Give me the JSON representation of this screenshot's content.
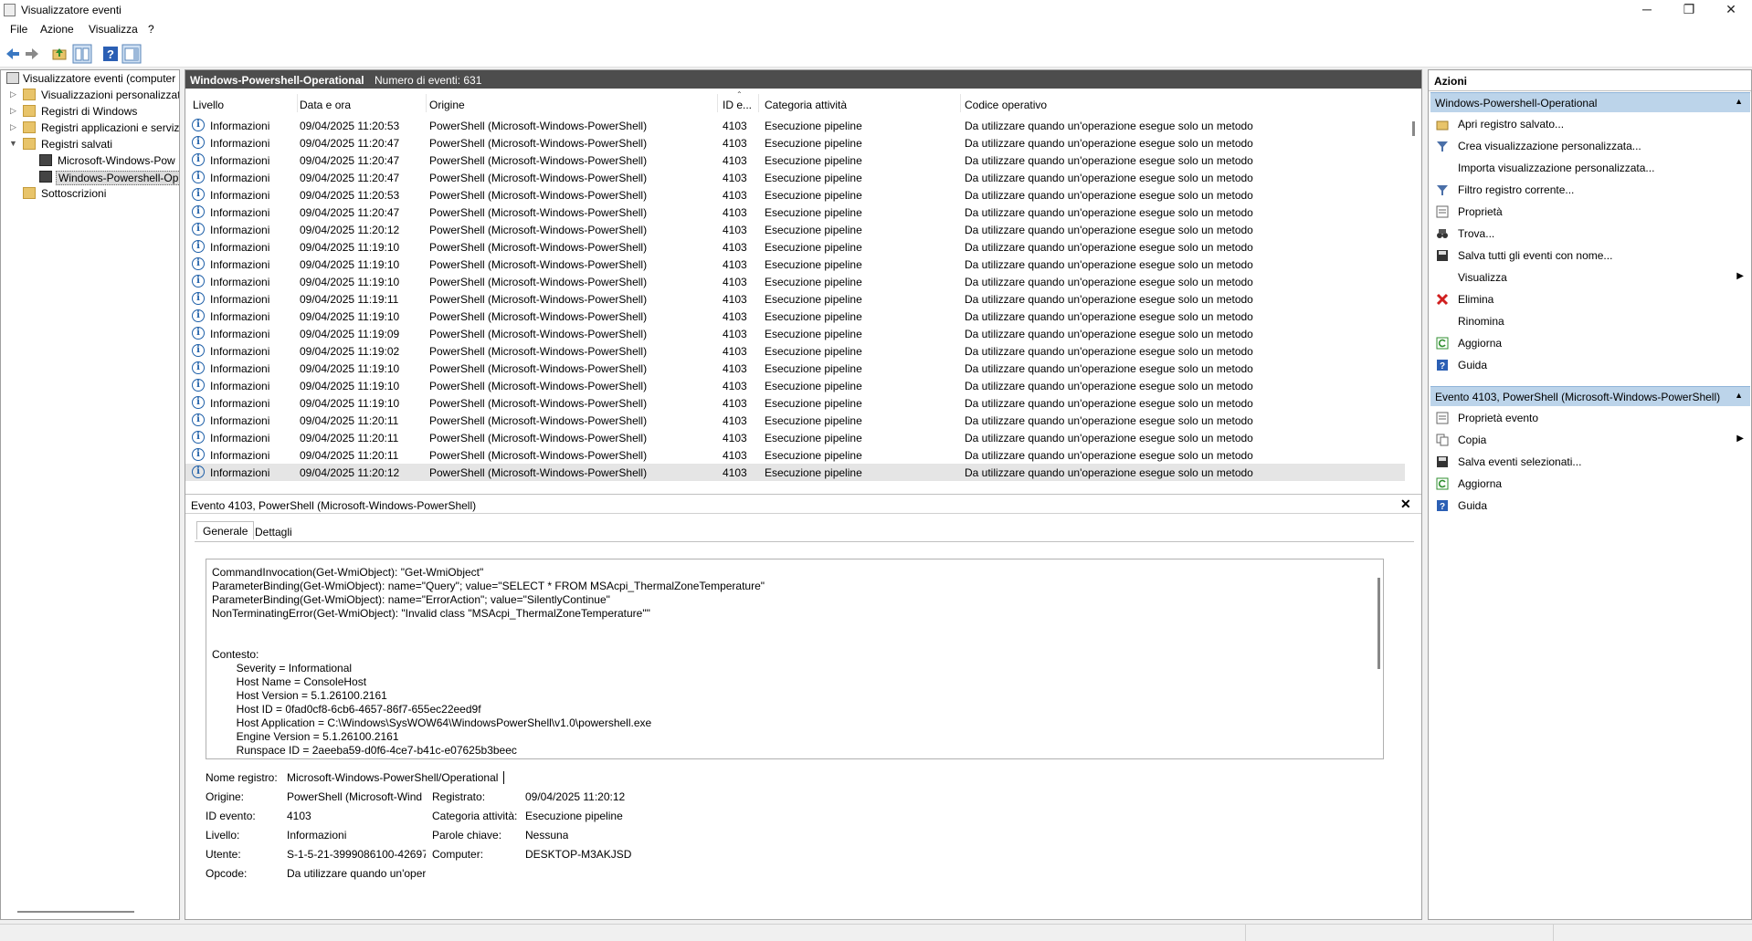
{
  "window": {
    "title": "Visualizzatore eventi",
    "minimize": "─",
    "maximize": "❐",
    "close": "✕"
  },
  "menu": [
    "File",
    "Azione",
    "Visualizza",
    "?"
  ],
  "tree": {
    "root": "Visualizzatore eventi (computer",
    "custom_views": "Visualizzazioni personalizzate",
    "windows_logs": "Registri di Windows",
    "app_logs": "Registri applicazioni e servizi",
    "saved_logs": "Registri salvati",
    "saved_1": "Microsoft-Windows-Pow",
    "saved_2": "Windows-Powershell-Op",
    "subscriptions": "Sottoscrizioni"
  },
  "list": {
    "title": "Windows-Powershell-Operational",
    "count": "Numero di eventi: 631",
    "columns": [
      "Livello",
      "Data e ora",
      "Origine",
      "ID e...",
      "Categoria attività",
      "Codice operativo"
    ],
    "rows": [
      {
        "level": "Informazioni",
        "date": "09/04/2025 11:20:53",
        "source": "PowerShell (Microsoft-Windows-PowerShell)",
        "id": "4103",
        "category": "Esecuzione pipeline",
        "opcode": "Da utilizzare quando un'operazione esegue solo un metodo"
      },
      {
        "level": "Informazioni",
        "date": "09/04/2025 11:20:47",
        "source": "PowerShell (Microsoft-Windows-PowerShell)",
        "id": "4103",
        "category": "Esecuzione pipeline",
        "opcode": "Da utilizzare quando un'operazione esegue solo un metodo"
      },
      {
        "level": "Informazioni",
        "date": "09/04/2025 11:20:47",
        "source": "PowerShell (Microsoft-Windows-PowerShell)",
        "id": "4103",
        "category": "Esecuzione pipeline",
        "opcode": "Da utilizzare quando un'operazione esegue solo un metodo"
      },
      {
        "level": "Informazioni",
        "date": "09/04/2025 11:20:47",
        "source": "PowerShell (Microsoft-Windows-PowerShell)",
        "id": "4103",
        "category": "Esecuzione pipeline",
        "opcode": "Da utilizzare quando un'operazione esegue solo un metodo"
      },
      {
        "level": "Informazioni",
        "date": "09/04/2025 11:20:53",
        "source": "PowerShell (Microsoft-Windows-PowerShell)",
        "id": "4103",
        "category": "Esecuzione pipeline",
        "opcode": "Da utilizzare quando un'operazione esegue solo un metodo"
      },
      {
        "level": "Informazioni",
        "date": "09/04/2025 11:20:47",
        "source": "PowerShell (Microsoft-Windows-PowerShell)",
        "id": "4103",
        "category": "Esecuzione pipeline",
        "opcode": "Da utilizzare quando un'operazione esegue solo un metodo"
      },
      {
        "level": "Informazioni",
        "date": "09/04/2025 11:20:12",
        "source": "PowerShell (Microsoft-Windows-PowerShell)",
        "id": "4103",
        "category": "Esecuzione pipeline",
        "opcode": "Da utilizzare quando un'operazione esegue solo un metodo"
      },
      {
        "level": "Informazioni",
        "date": "09/04/2025 11:19:10",
        "source": "PowerShell (Microsoft-Windows-PowerShell)",
        "id": "4103",
        "category": "Esecuzione pipeline",
        "opcode": "Da utilizzare quando un'operazione esegue solo un metodo"
      },
      {
        "level": "Informazioni",
        "date": "09/04/2025 11:19:10",
        "source": "PowerShell (Microsoft-Windows-PowerShell)",
        "id": "4103",
        "category": "Esecuzione pipeline",
        "opcode": "Da utilizzare quando un'operazione esegue solo un metodo"
      },
      {
        "level": "Informazioni",
        "date": "09/04/2025 11:19:10",
        "source": "PowerShell (Microsoft-Windows-PowerShell)",
        "id": "4103",
        "category": "Esecuzione pipeline",
        "opcode": "Da utilizzare quando un'operazione esegue solo un metodo"
      },
      {
        "level": "Informazioni",
        "date": "09/04/2025 11:19:11",
        "source": "PowerShell (Microsoft-Windows-PowerShell)",
        "id": "4103",
        "category": "Esecuzione pipeline",
        "opcode": "Da utilizzare quando un'operazione esegue solo un metodo"
      },
      {
        "level": "Informazioni",
        "date": "09/04/2025 11:19:10",
        "source": "PowerShell (Microsoft-Windows-PowerShell)",
        "id": "4103",
        "category": "Esecuzione pipeline",
        "opcode": "Da utilizzare quando un'operazione esegue solo un metodo"
      },
      {
        "level": "Informazioni",
        "date": "09/04/2025 11:19:09",
        "source": "PowerShell (Microsoft-Windows-PowerShell)",
        "id": "4103",
        "category": "Esecuzione pipeline",
        "opcode": "Da utilizzare quando un'operazione esegue solo un metodo"
      },
      {
        "level": "Informazioni",
        "date": "09/04/2025 11:19:02",
        "source": "PowerShell (Microsoft-Windows-PowerShell)",
        "id": "4103",
        "category": "Esecuzione pipeline",
        "opcode": "Da utilizzare quando un'operazione esegue solo un metodo"
      },
      {
        "level": "Informazioni",
        "date": "09/04/2025 11:19:10",
        "source": "PowerShell (Microsoft-Windows-PowerShell)",
        "id": "4103",
        "category": "Esecuzione pipeline",
        "opcode": "Da utilizzare quando un'operazione esegue solo un metodo"
      },
      {
        "level": "Informazioni",
        "date": "09/04/2025 11:19:10",
        "source": "PowerShell (Microsoft-Windows-PowerShell)",
        "id": "4103",
        "category": "Esecuzione pipeline",
        "opcode": "Da utilizzare quando un'operazione esegue solo un metodo"
      },
      {
        "level": "Informazioni",
        "date": "09/04/2025 11:19:10",
        "source": "PowerShell (Microsoft-Windows-PowerShell)",
        "id": "4103",
        "category": "Esecuzione pipeline",
        "opcode": "Da utilizzare quando un'operazione esegue solo un metodo"
      },
      {
        "level": "Informazioni",
        "date": "09/04/2025 11:20:11",
        "source": "PowerShell (Microsoft-Windows-PowerShell)",
        "id": "4103",
        "category": "Esecuzione pipeline",
        "opcode": "Da utilizzare quando un'operazione esegue solo un metodo"
      },
      {
        "level": "Informazioni",
        "date": "09/04/2025 11:20:11",
        "source": "PowerShell (Microsoft-Windows-PowerShell)",
        "id": "4103",
        "category": "Esecuzione pipeline",
        "opcode": "Da utilizzare quando un'operazione esegue solo un metodo"
      },
      {
        "level": "Informazioni",
        "date": "09/04/2025 11:20:11",
        "source": "PowerShell (Microsoft-Windows-PowerShell)",
        "id": "4103",
        "category": "Esecuzione pipeline",
        "opcode": "Da utilizzare quando un'operazione esegue solo un metodo"
      },
      {
        "level": "Informazioni",
        "date": "09/04/2025 11:20:12",
        "source": "PowerShell (Microsoft-Windows-PowerShell)",
        "id": "4103",
        "category": "Esecuzione pipeline",
        "opcode": "Da utilizzare quando un'operazione esegue solo un metodo"
      }
    ]
  },
  "detail": {
    "title": "Evento 4103, PowerShell (Microsoft-Windows-PowerShell)",
    "close": "✕",
    "tabs": [
      "Generale",
      "Dettagli"
    ],
    "message": [
      "CommandInvocation(Get-WmiObject): \"Get-WmiObject\"",
      "ParameterBinding(Get-WmiObject): name=\"Query\"; value=\"SELECT * FROM MSAcpi_ThermalZoneTemperature\"",
      "ParameterBinding(Get-WmiObject): name=\"ErrorAction\"; value=\"SilentlyContinue\"",
      "NonTerminatingError(Get-WmiObject): \"Invalid class \"MSAcpi_ThermalZoneTemperature\"\"",
      "",
      "",
      "Contesto:",
      "        Severity = Informational",
      "        Host Name = ConsoleHost",
      "        Host Version = 5.1.26100.2161",
      "        Host ID = 0fad0cf8-6cb6-4657-86f7-655ec22eed9f",
      "        Host Application = C:\\Windows\\SysWOW64\\WindowsPowerShell\\v1.0\\powershell.exe",
      "        Engine Version = 5.1.26100.2161",
      "        Runspace ID = 2aeeba59-d0f6-4ce7-b41c-e07625b3beec"
    ],
    "fields": {
      "log_name_label": "Nome registro:",
      "log_name": "Microsoft-Windows-PowerShell/Operational",
      "source_label": "Origine:",
      "source": "PowerShell (Microsoft-Wind",
      "logged_label": "Registrato:",
      "logged": "09/04/2025 11:20:12",
      "event_id_label": "ID evento:",
      "event_id": "4103",
      "task_label": "Categoria attività:",
      "task": "Esecuzione pipeline",
      "level_label": "Livello:",
      "level": "Informazioni",
      "keywords_label": "Parole chiave:",
      "keywords": "Nessuna",
      "user_label": "Utente:",
      "user": "S-1-5-21-3999086100-426973",
      "computer_label": "Computer:",
      "computer": "DESKTOP-M3AKJSD",
      "opcode_label": "Opcode:",
      "opcode": "Da utilizzare quando un'oper"
    }
  },
  "actions": {
    "title": "Azioni",
    "section1": "Windows-Powershell-Operational",
    "items1": [
      {
        "label": "Apri registro salvato...",
        "icon": "open-folder-icon"
      },
      {
        "label": "Crea visualizzazione personalizzata...",
        "icon": "filter-icon"
      },
      {
        "label": "Importa visualizzazione personalizzata...",
        "icon": ""
      },
      {
        "label": "Filtro registro corrente...",
        "icon": "filter-icon"
      },
      {
        "label": "Proprietà",
        "icon": "properties-icon"
      },
      {
        "label": "Trova...",
        "icon": "binoculars-icon"
      },
      {
        "label": "Salva tutti gli eventi con nome...",
        "icon": "save-icon"
      },
      {
        "label": "Visualizza",
        "icon": "",
        "submenu": true
      },
      {
        "label": "Elimina",
        "icon": "delete-icon"
      },
      {
        "label": "Rinomina",
        "icon": ""
      },
      {
        "label": "Aggiorna",
        "icon": "refresh-icon"
      },
      {
        "label": "Guida",
        "icon": "help-icon"
      }
    ],
    "section2": "Evento 4103, PowerShell (Microsoft-Windows-PowerShell)",
    "items2": [
      {
        "label": "Proprietà evento",
        "icon": "properties-icon"
      },
      {
        "label": "Copia",
        "icon": "copy-icon",
        "submenu": true
      },
      {
        "label": "Salva eventi selezionati...",
        "icon": "save-icon"
      },
      {
        "label": "Aggiorna",
        "icon": "refresh-icon"
      },
      {
        "label": "Guida",
        "icon": "help-icon"
      }
    ]
  }
}
